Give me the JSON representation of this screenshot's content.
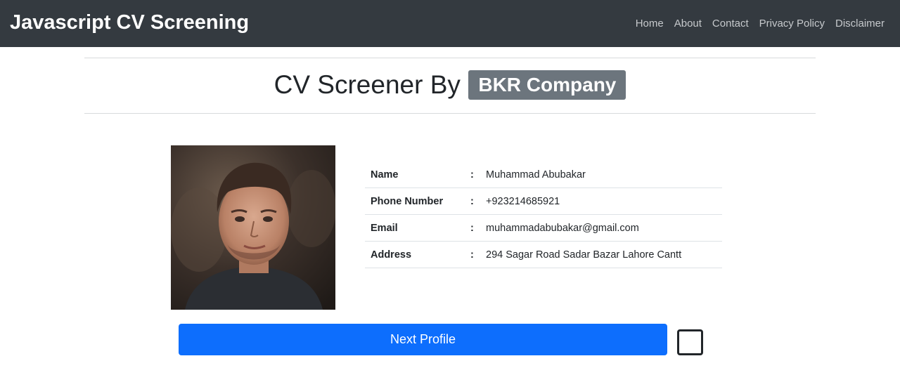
{
  "navbar": {
    "brand": "Javascript CV Screening",
    "links": [
      {
        "label": "Home"
      },
      {
        "label": "About"
      },
      {
        "label": "Contact"
      },
      {
        "label": "Privacy Policy"
      },
      {
        "label": "Disclaimer"
      }
    ]
  },
  "heading": {
    "text": "CV Screener By",
    "badge": "BKR Company"
  },
  "profile": {
    "photo_alt": "profile photo",
    "rows": [
      {
        "label": "Name",
        "separator": ":",
        "value": "Muhammad Abubakar"
      },
      {
        "label": "Phone Number",
        "separator": ":",
        "value": "+923214685921"
      },
      {
        "label": "Email",
        "separator": ":",
        "value": "muhammadabubakar@gmail.com"
      },
      {
        "label": "Address",
        "separator": ":",
        "value": "294 Sagar Road Sadar Bazar Lahore Cantt"
      }
    ]
  },
  "actions": {
    "next_label": "Next Profile",
    "checkbox_checked": false
  },
  "colors": {
    "navbar_bg": "#343a40",
    "primary": "#0d6efd",
    "badge_bg": "#6c757d"
  }
}
